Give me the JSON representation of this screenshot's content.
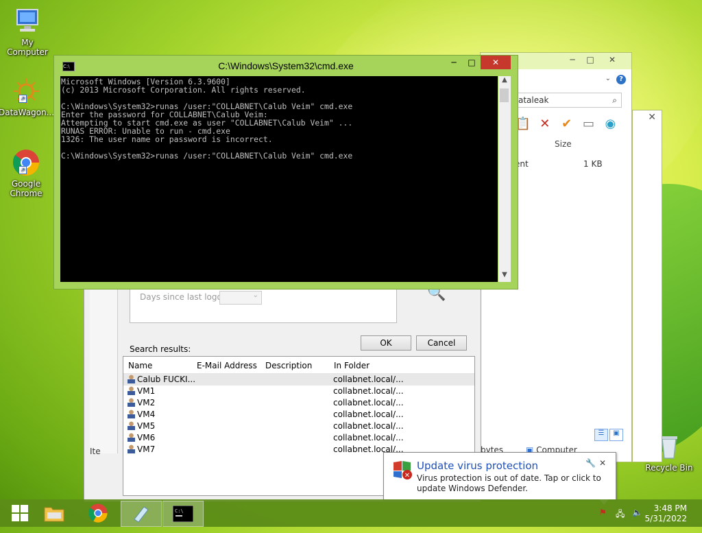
{
  "desktop": {
    "icons": [
      {
        "label": "My Computer"
      },
      {
        "label": "DataWagon..."
      },
      {
        "label": "Google Chrome"
      },
      {
        "label": "Recycle Bin"
      }
    ]
  },
  "cmd": {
    "title": "C:\\Windows\\System32\\cmd.exe",
    "minimize": "─",
    "maximize": "□",
    "close": "✕",
    "lines": [
      "Microsoft Windows [Version 6.3.9600]",
      "(c) 2013 Microsoft Corporation. All rights reserved.",
      "",
      "C:\\Windows\\System32>runas /user:\"COLLABNET\\Calub Veim\" cmd.exe",
      "Enter the password for COLLABNET\\Calub Veim:",
      "Attempting to start cmd.exe as user \"COLLABNET\\Calub Veim\" ...",
      "RUNAS ERROR: Unable to run - cmd.exe",
      "1326: The user name or password is incorrect.",
      "",
      "C:\\Windows\\System32>runas /user:\"COLLABNET\\Calub Veim\" cmd.exe"
    ]
  },
  "explorer": {
    "address": "ataleak",
    "size_header": "Size",
    "row_name": "ent",
    "row_size": "1 KB",
    "status_bytes": "bytes",
    "status_computer": "Computer"
  },
  "find_dialog": {
    "days_since_logon": "Days since last logon:",
    "ok": "OK",
    "cancel": "Cancel",
    "search_results_label": "Search results:",
    "columns": [
      "Name",
      "E-Mail Address",
      "Description",
      "In Folder"
    ],
    "rows": [
      {
        "name": "Calub FUCKI...",
        "folder": "collabnet.local/..."
      },
      {
        "name": "VM1",
        "folder": "collabnet.local/..."
      },
      {
        "name": "VM2",
        "folder": "collabnet.local/..."
      },
      {
        "name": "VM4",
        "folder": "collabnet.local/..."
      },
      {
        "name": "VM5",
        "folder": "collabnet.local/..."
      },
      {
        "name": "VM6",
        "folder": "collabnet.local/..."
      },
      {
        "name": "VM7",
        "folder": "collabnet.local/..."
      }
    ],
    "side_label": "Ite"
  },
  "balloon": {
    "title": "Update virus protection",
    "body": "Virus protection is out of date. Tap or click to update Windows Defender."
  },
  "taskbar": {
    "time": "3:48 PM",
    "date": "5/31/2022"
  }
}
